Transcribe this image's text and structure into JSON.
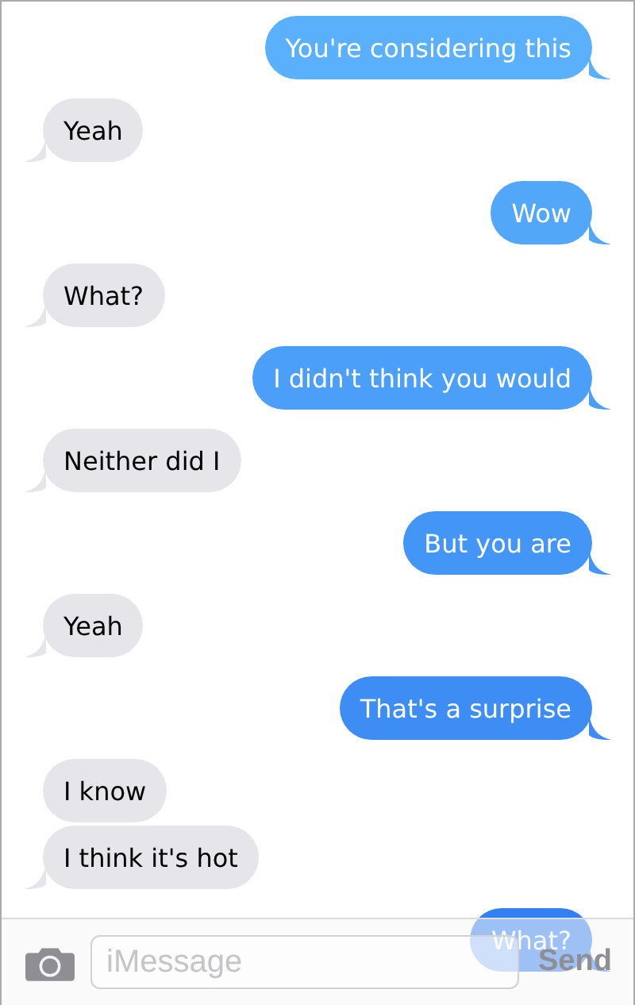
{
  "messages": [
    {
      "text": "You're considering this",
      "kind": "outgoing",
      "tail": true
    },
    {
      "text": "Yeah",
      "kind": "incoming",
      "tail": true
    },
    {
      "text": "Wow",
      "kind": "outgoing",
      "tail": true
    },
    {
      "text": "What?",
      "kind": "incoming",
      "tail": true
    },
    {
      "text": "I didn't think you would",
      "kind": "outgoing",
      "tail": true
    },
    {
      "text": "Neither did I",
      "kind": "incoming",
      "tail": true
    },
    {
      "text": "But you are",
      "kind": "outgoing",
      "tail": true
    },
    {
      "text": "Yeah",
      "kind": "incoming",
      "tail": true
    },
    {
      "text": "That's a surprise",
      "kind": "outgoing",
      "tail": true
    },
    {
      "text": "I know",
      "kind": "incoming",
      "tail": false
    },
    {
      "text": "I think it's hot",
      "kind": "incoming",
      "tail": true
    },
    {
      "text": "What?",
      "kind": "outgoing",
      "tail": true
    }
  ],
  "composer": {
    "placeholder": "iMessage",
    "send_label": "Send"
  }
}
